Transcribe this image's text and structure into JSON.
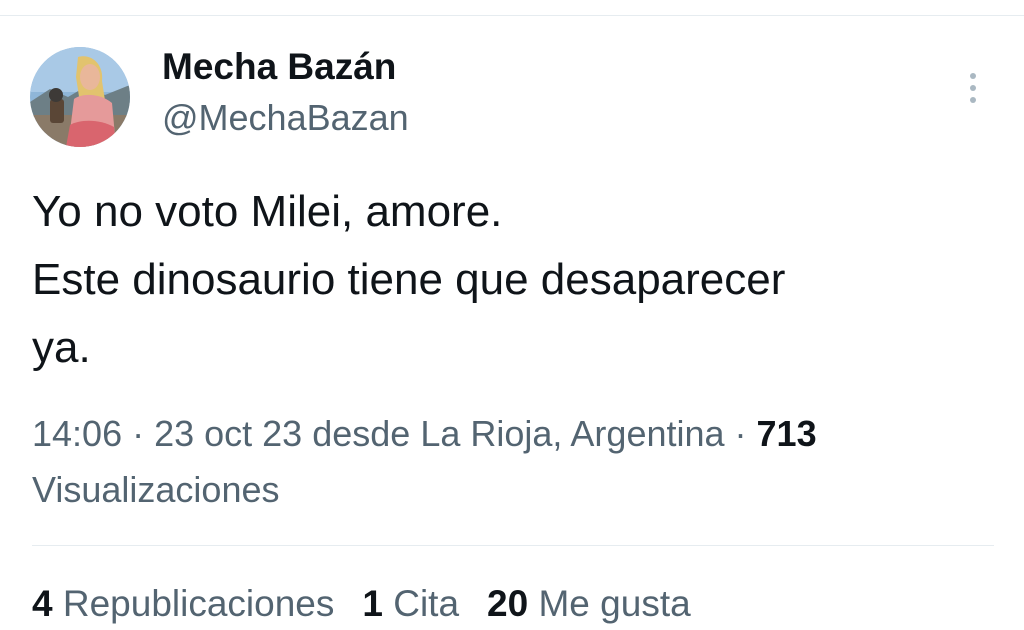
{
  "tweet": {
    "author": {
      "name": "Mecha Bazán",
      "handle": "@MechaBazan",
      "avatar_icon": "profile-photo"
    },
    "more_icon": "more-vertical-icon",
    "text_lines": [
      "Yo no voto Milei, amore.",
      "Este dinosaurio tiene que desaparecer",
      "ya."
    ],
    "meta": {
      "time": "14:06",
      "separator": " · ",
      "date": "23 oct 23",
      "location": "desde La Rioja, Argentina",
      "views_count": "713",
      "views_label": "Visualizaciones"
    },
    "stats": [
      {
        "count": "4",
        "label": "Republicaciones"
      },
      {
        "count": "1",
        "label": "Cita"
      },
      {
        "count": "20",
        "label": "Me gusta"
      }
    ]
  },
  "colors": {
    "text_primary": "#0f1419",
    "text_secondary": "#536471",
    "divider": "#e6ecf0",
    "more_dots": "#aab8c2"
  }
}
